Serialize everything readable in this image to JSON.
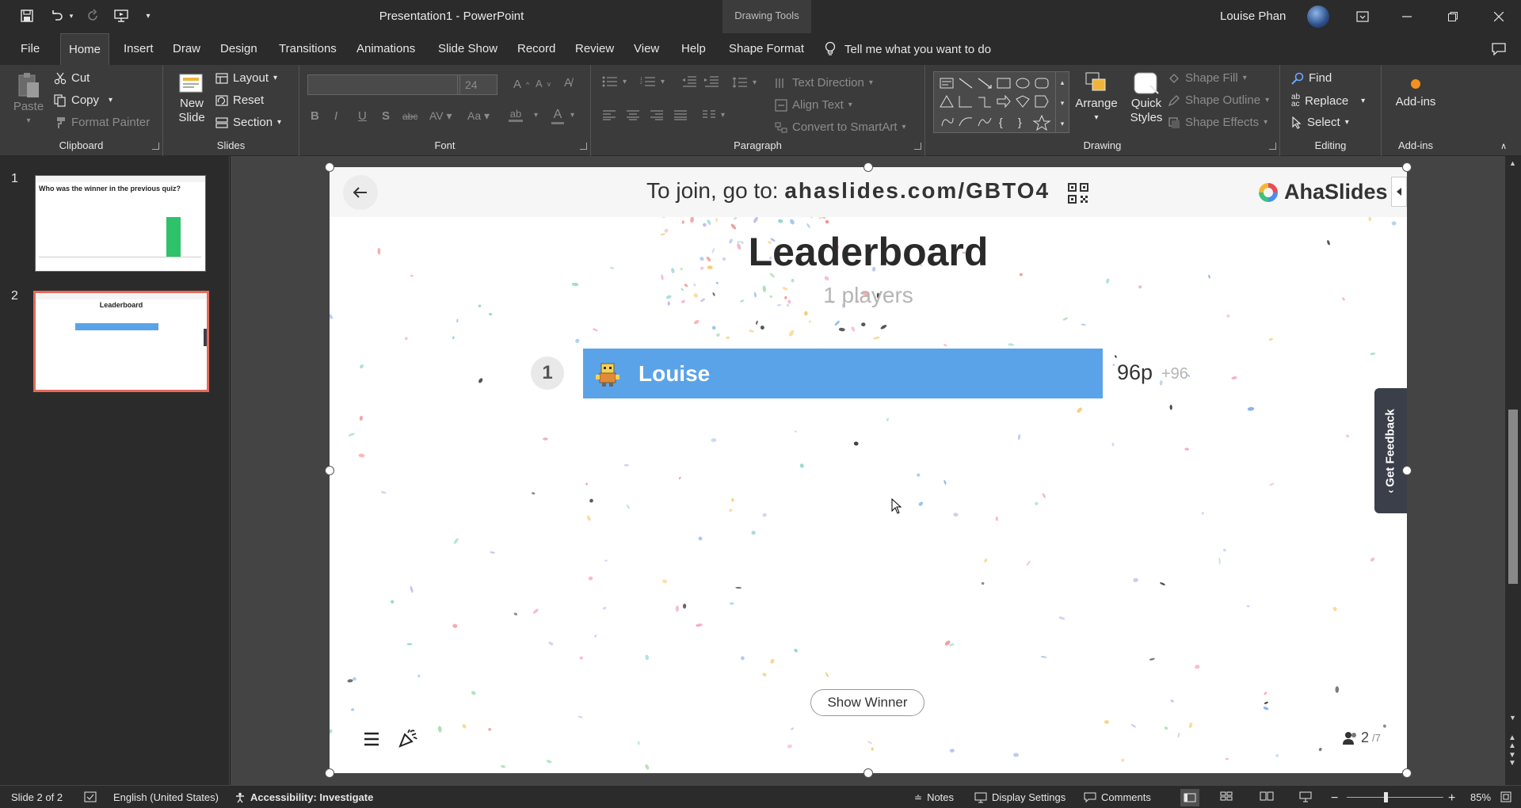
{
  "window": {
    "title": "Presentation1 - PowerPoint",
    "contextual_tab_group": "Drawing Tools",
    "user_name": "Louise Phan"
  },
  "ribbon_tabs": [
    "File",
    "Home",
    "Insert",
    "Draw",
    "Design",
    "Transitions",
    "Animations",
    "Slide Show",
    "Record",
    "Review",
    "View",
    "Help",
    "Shape Format"
  ],
  "active_tab": "Home",
  "tell_me": "Tell me what you want to do",
  "ribbon": {
    "clipboard": {
      "paste": "Paste",
      "cut": "Cut",
      "copy": "Copy",
      "format_painter": "Format Painter",
      "label": "Clipboard"
    },
    "slides": {
      "new_slide": "New Slide",
      "layout": "Layout",
      "reset": "Reset",
      "section": "Section",
      "label": "Slides"
    },
    "font": {
      "size": "24",
      "label": "Font"
    },
    "paragraph": {
      "text_direction": "Text Direction",
      "align_text": "Align Text",
      "convert_smartart": "Convert to SmartArt",
      "label": "Paragraph"
    },
    "drawing": {
      "arrange": "Arrange",
      "quick_styles": "Quick Styles",
      "shape_fill": "Shape Fill",
      "shape_outline": "Shape Outline",
      "shape_effects": "Shape Effects",
      "label": "Drawing"
    },
    "editing": {
      "find": "Find",
      "replace": "Replace",
      "select": "Select",
      "label": "Editing"
    },
    "addins": {
      "button": "Add-ins",
      "label": "Add-ins"
    }
  },
  "thumbnails": [
    {
      "number": "1",
      "title": "Who was the winner in the previous quiz?"
    },
    {
      "number": "2",
      "title": "Leaderboard"
    }
  ],
  "slide": {
    "join_prefix": "To join, go to:",
    "join_url": "ahaslides.com/GBTO4",
    "brand": "AhaSlides",
    "title": "Leaderboard",
    "subtitle": "1 players",
    "entry": {
      "rank": "1",
      "name": "Louise",
      "score": "96p",
      "delta": "+96"
    },
    "show_winner": "Show Winner",
    "audience_count": "2",
    "audience_total": "/7",
    "feedback": "Get Feedback"
  },
  "status": {
    "slide_info": "Slide 2 of 2",
    "language": "English (United States)",
    "accessibility": "Accessibility: Investigate",
    "notes": "Notes",
    "display_settings": "Display Settings",
    "comments": "Comments",
    "zoom": "85%"
  },
  "colors": {
    "player_bar": "#5ba3e8",
    "selected_thumb": "#e46a5a",
    "ribbon": "#3b3b3b"
  }
}
